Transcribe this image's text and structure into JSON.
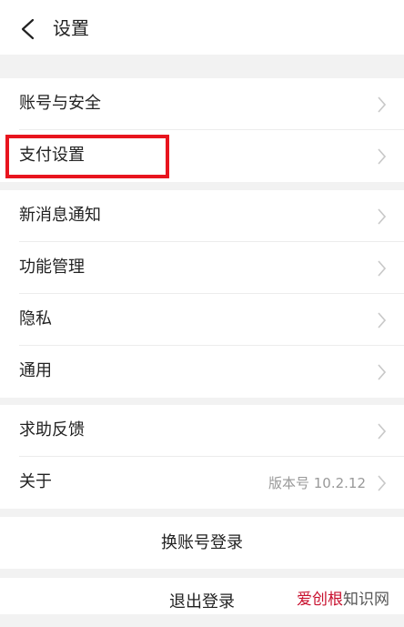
{
  "header": {
    "title": "设置",
    "back_icon": "back-arrow-icon"
  },
  "groups": [
    {
      "items": [
        {
          "label": "账号与安全"
        },
        {
          "label": "支付设置"
        }
      ]
    },
    {
      "items": [
        {
          "label": "新消息通知"
        },
        {
          "label": "功能管理"
        },
        {
          "label": "隐私"
        },
        {
          "label": "通用"
        }
      ]
    },
    {
      "items": [
        {
          "label": "求助反馈"
        },
        {
          "label": "关于",
          "value": "版本号 10.2.12"
        }
      ]
    }
  ],
  "actions": {
    "switch_account": "换账号登录",
    "logout": "退出登录"
  },
  "watermark": {
    "part1": "爱创根",
    "part2": "知识网"
  },
  "colors": {
    "accent_highlight": "#e8141e",
    "background": "#f2f2f2",
    "chevron": "#c8c8c8"
  }
}
